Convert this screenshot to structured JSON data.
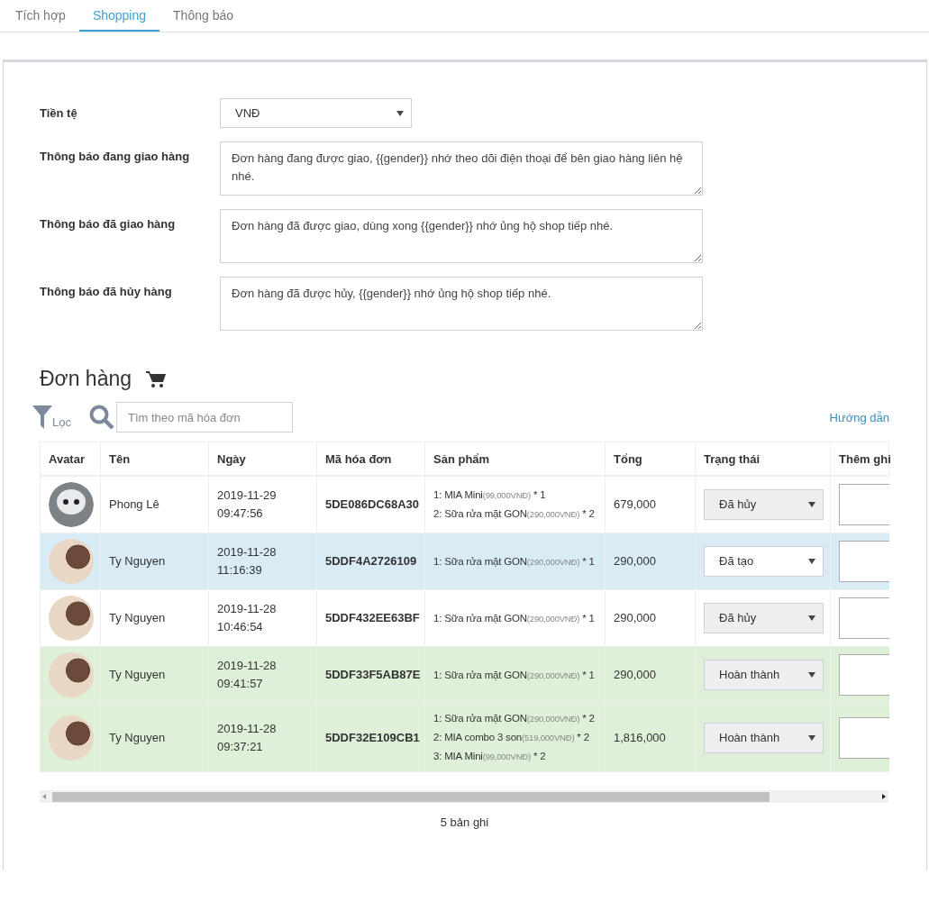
{
  "tabs": [
    {
      "label": "Tích hợp",
      "selected": false
    },
    {
      "label": "Shopping",
      "selected": true
    },
    {
      "label": "Thông báo",
      "selected": false
    }
  ],
  "settings": {
    "currency": {
      "label": "Tiền tệ",
      "value": "VNĐ"
    },
    "messages": [
      {
        "label": "Thông báo đang giao hàng",
        "value": "Đơn hàng đang được giao, {{gender}} nhớ theo dõi điện thoại để bên giao hàng liên hệ nhé."
      },
      {
        "label": "Thông báo đã giao hàng",
        "value": "Đơn hàng đã được giao, dùng xong {{gender}} nhớ ủng hộ shop tiếp nhé."
      },
      {
        "label": "Thông báo đã hủy hàng",
        "value": "Đơn hàng đã được hủy, {{gender}} nhớ ủng hộ shop tiếp nhé."
      }
    ]
  },
  "orders": {
    "title": "Đơn hàng",
    "filter_label": "Lọc",
    "search": {
      "placeholder": "Tìm theo mã hóa đơn"
    },
    "help_link": "Hướng dẫn",
    "columns": [
      "Avatar",
      "Tên",
      "Ngày",
      "Mã hóa đơn",
      "Sản phẩm",
      "Tổng",
      "Trạng thái",
      "Thêm ghi"
    ],
    "rows": [
      {
        "kind": "cancelled",
        "avatar": {
          "kind": "robot"
        },
        "name": "Phong Lê",
        "date": "2019-11-29",
        "time": "09:47:56",
        "invoice": "5DE086DC68A30",
        "products": [
          {
            "name": "1: MIA Mini",
            "price": "(99,000VNĐ)",
            "qty": " * 1"
          },
          {
            "name": "2: Sữa rửa mặt GON",
            "price": "(290,000VNĐ)",
            "qty": " * 2"
          }
        ],
        "total": "679,000",
        "status": {
          "value": "Đã hủy",
          "disabled": true
        }
      },
      {
        "kind": "created",
        "avatar": {
          "kind": "photo"
        },
        "name": "Ty Nguyen",
        "date": "2019-11-28",
        "time": "11:16:39",
        "invoice": "5DDF4A2726109",
        "products": [
          {
            "name": "1: Sữa rửa mặt GON",
            "price": "(290,000VNĐ)",
            "qty": " * 1"
          }
        ],
        "total": "290,000",
        "status": {
          "value": "Đã tạo",
          "disabled": false
        }
      },
      {
        "kind": "cancelled",
        "avatar": {
          "kind": "photo"
        },
        "name": "Ty Nguyen",
        "date": "2019-11-28",
        "time": "10:46:54",
        "invoice": "5DDF432EE63BF",
        "products": [
          {
            "name": "1: Sữa rửa mặt GON",
            "price": "(290,000VNĐ)",
            "qty": " * 1"
          }
        ],
        "total": "290,000",
        "status": {
          "value": "Đã hủy",
          "disabled": true
        }
      },
      {
        "kind": "done",
        "avatar": {
          "kind": "photo"
        },
        "name": "Ty Nguyen",
        "date": "2019-11-28",
        "time": "09:41:57",
        "invoice": "5DDF33F5AB87E",
        "products": [
          {
            "name": "1: Sữa rửa mặt GON",
            "price": "(290,000VNĐ)",
            "qty": " * 1"
          }
        ],
        "total": "290,000",
        "status": {
          "value": "Hoàn thành",
          "disabled": true
        }
      },
      {
        "kind": "done",
        "avatar": {
          "kind": "photo"
        },
        "name": "Ty Nguyen",
        "date": "2019-11-28",
        "time": "09:37:21",
        "invoice": "5DDF32E109CB1",
        "products": [
          {
            "name": "1: Sữa rửa mặt GON",
            "price": "(290,000VNĐ)",
            "qty": " * 2"
          },
          {
            "name": "2: MIA combo 3 son",
            "price": "(519,000VNĐ)",
            "qty": " * 2"
          },
          {
            "name": "3: MIA Mini",
            "price": "(99,000VNĐ)",
            "qty": " * 2"
          }
        ],
        "total": "1,816,000",
        "status": {
          "value": "Hoàn thành",
          "disabled": true
        }
      }
    ],
    "record_count": "5 bản ghi"
  }
}
